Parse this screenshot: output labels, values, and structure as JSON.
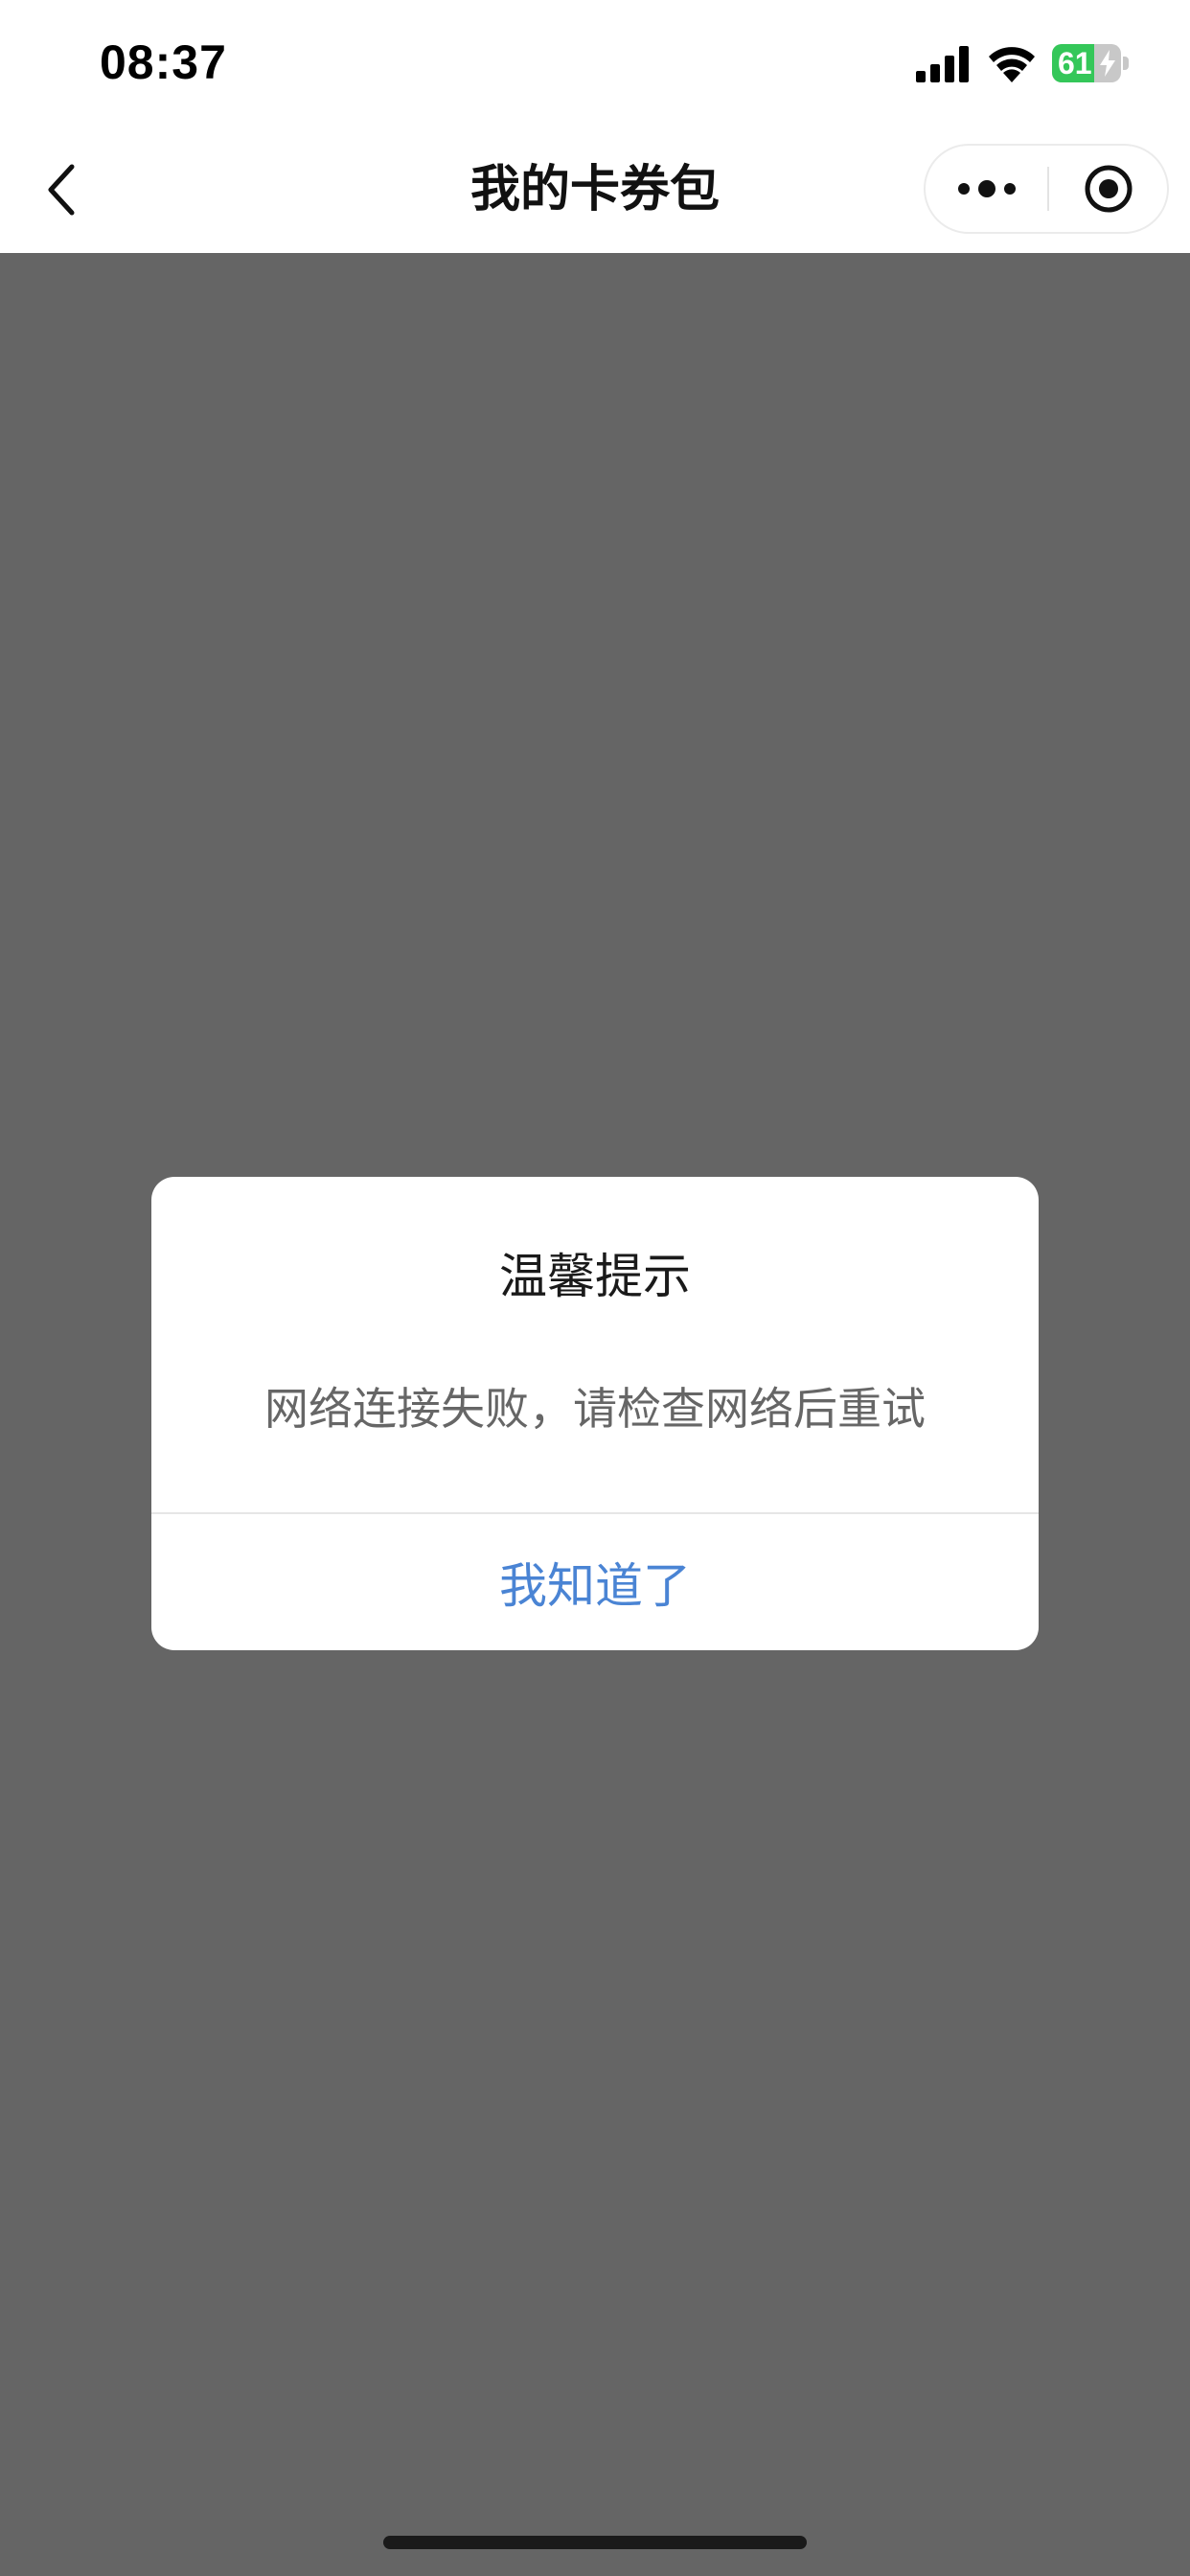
{
  "status_bar": {
    "time": "08:37",
    "battery_text": "61",
    "battery_level": 0.61,
    "battery_color": "#34c759"
  },
  "nav": {
    "title": "我的卡券包",
    "back_icon": "chevron-left-icon",
    "more_icon": "more-dots-icon",
    "close_icon": "target-circle-icon"
  },
  "overlay_color": "#656565",
  "dialog": {
    "title": "温馨提示",
    "message": "网络连接失败，请检查网络后重试",
    "confirm_label": "我知道了",
    "confirm_color": "#4a84d4"
  }
}
